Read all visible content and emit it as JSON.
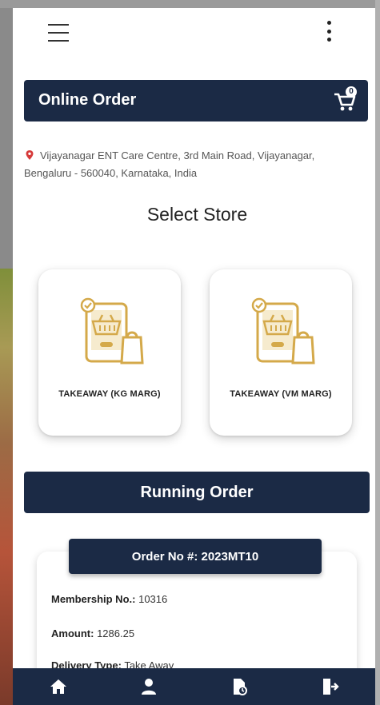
{
  "header": {
    "title": "Online Order",
    "cart_count": "0"
  },
  "location": {
    "address": "Vijayanagar ENT Care Centre, 3rd Main Road, Vijayanagar, Bengaluru - 560040, Karnataka, India"
  },
  "stores": {
    "heading": "Select Store",
    "items": [
      {
        "label": "TAKEAWAY (KG MARG)"
      },
      {
        "label": "TAKEAWAY (VM MARG)"
      }
    ]
  },
  "running_order": {
    "heading": "Running Order",
    "order_no": "Order No #: 2023MT10",
    "membership_label": "Membership No.:",
    "membership_value": "10316",
    "amount_label": "Amount:",
    "amount_value": "1286.25",
    "delivery_label": "Delivery Type:",
    "delivery_value": "Take Away"
  },
  "bottom_nav": [
    "home-icon",
    "profile-icon",
    "orders-icon",
    "logout-icon"
  ],
  "colors": {
    "primary": "#1b2a45",
    "accent_gold": "#d4a94a",
    "pin_red": "#d63a3a"
  }
}
